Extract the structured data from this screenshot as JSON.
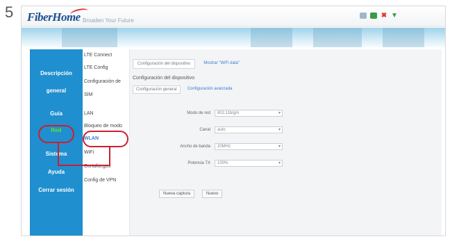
{
  "step": "5",
  "header": {
    "logo": "FiberHome",
    "tagline": "Broaden Your Future",
    "icons": [
      "mail-icon",
      "monitor-icon",
      "close-icon",
      "wifi-icon"
    ]
  },
  "sidebar": {
    "items": [
      {
        "label": "Descripción",
        "label2": "general"
      },
      {
        "label": "Guía"
      },
      {
        "label": "Red"
      },
      {
        "label": "Sistema"
      },
      {
        "label": "Ayuda"
      },
      {
        "label": "Cerrar sesión"
      }
    ],
    "color": "#1f8fcf",
    "selected_color": "#66e02a"
  },
  "submenu": {
    "items": [
      {
        "label": "LTE Connect"
      },
      {
        "label": "LTE Config"
      },
      {
        "label": "Configuración de",
        "label2": "SIM"
      },
      {
        "label": "LAN"
      },
      {
        "label": "Bloqueo de modo"
      },
      {
        "label": "WLAN"
      },
      {
        "label": "WiFi"
      },
      {
        "label": "Cortafuegos"
      },
      {
        "label": "Config de VPN"
      }
    ]
  },
  "content": {
    "tabs": [
      {
        "label": "Configuración del dispositivo"
      },
      {
        "label": "Mostrar \"WiFi data\""
      }
    ],
    "section_title": "Configuración del dispositivo",
    "subtabs": [
      {
        "label": "Configuración general"
      },
      {
        "label": "Configuración avanzada"
      }
    ],
    "fields": [
      {
        "label": "Modo de red",
        "value": "802.11b/g/n"
      },
      {
        "label": "Canal",
        "value": "auto"
      },
      {
        "label": "Ancho de banda",
        "value": "20MHz"
      },
      {
        "label": "Potencia TX",
        "value": "100%"
      }
    ],
    "buttons": [
      {
        "label": "Nueva captura"
      },
      {
        "label": "Nuevo"
      }
    ]
  },
  "colors": {
    "annotation": "#cc1f2f",
    "accent": "#1f8fcf"
  }
}
